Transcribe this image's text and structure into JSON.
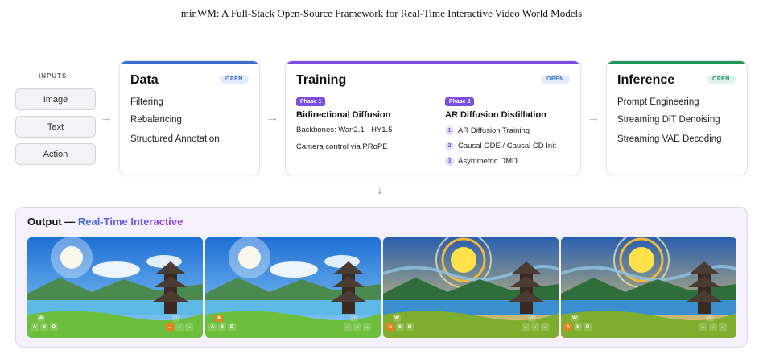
{
  "paper_title": "minWM: A Full-Stack Open-Source Framework for Real-Time Interactive Video World Models",
  "inputs": {
    "label": "INPUTS",
    "items": [
      "Image",
      "Text",
      "Action"
    ]
  },
  "arrow_glyph": "→",
  "down_arrow_glyph": "↓",
  "data_card": {
    "title": "Data",
    "badge": "OPEN",
    "items": [
      "Filtering",
      "Rebalancing",
      "Structured Annotation"
    ],
    "accent": "#3d6fd1"
  },
  "training_card": {
    "title": "Training",
    "badge": "OPEN",
    "accent": "#7c4de0",
    "phase1": {
      "pill": "Phase 1",
      "heading": "Bidirectional Diffusion",
      "lines": [
        "Backbones: Wan2.1 · HY1.5",
        "Camera control via PRoPE"
      ]
    },
    "phase2": {
      "pill": "Phase 2",
      "heading": "AR Diffusion Distillation",
      "steps": [
        {
          "n": "1",
          "text": "AR Diffusion Training"
        },
        {
          "n": "2",
          "text": "Causal ODE / Causal CD Init"
        },
        {
          "n": "3",
          "text": "Asymmetric DMD"
        }
      ]
    }
  },
  "inference_card": {
    "title": "Inference",
    "badge": "OPEN",
    "items": [
      "Prompt Engineering",
      "Streaming DiT Denoising",
      "Streaming VAE Decoding"
    ],
    "accent": "#23955f"
  },
  "output": {
    "title_prefix": "Output —",
    "title_highlight": "Real-Time Interactive",
    "frames": [
      {
        "style": "anime",
        "wasd": [
          "W",
          "A",
          "S",
          "D"
        ],
        "active_wasd": "",
        "arrows": [
          "↑",
          "←",
          "↓",
          "→"
        ],
        "active_arrow": "←"
      },
      {
        "style": "anime",
        "wasd": [
          "W",
          "A",
          "S",
          "D"
        ],
        "active_wasd": "W",
        "arrows": [
          "↑",
          "←",
          "↓",
          "→"
        ],
        "active_arrow": ""
      },
      {
        "style": "vangogh",
        "wasd": [
          "W",
          "A",
          "S",
          "D"
        ],
        "active_wasd": "A",
        "arrows": [
          "↑",
          "←",
          "↓",
          "→"
        ],
        "active_arrow": ""
      },
      {
        "style": "vangogh",
        "wasd": [
          "W",
          "A",
          "S",
          "D"
        ],
        "active_wasd": "A",
        "arrows": [
          "↑",
          "←",
          "↓",
          "→"
        ],
        "active_arrow": ""
      }
    ]
  },
  "colors": {
    "key_active": "#e8831c",
    "phase_pill": "#7c4de0"
  }
}
